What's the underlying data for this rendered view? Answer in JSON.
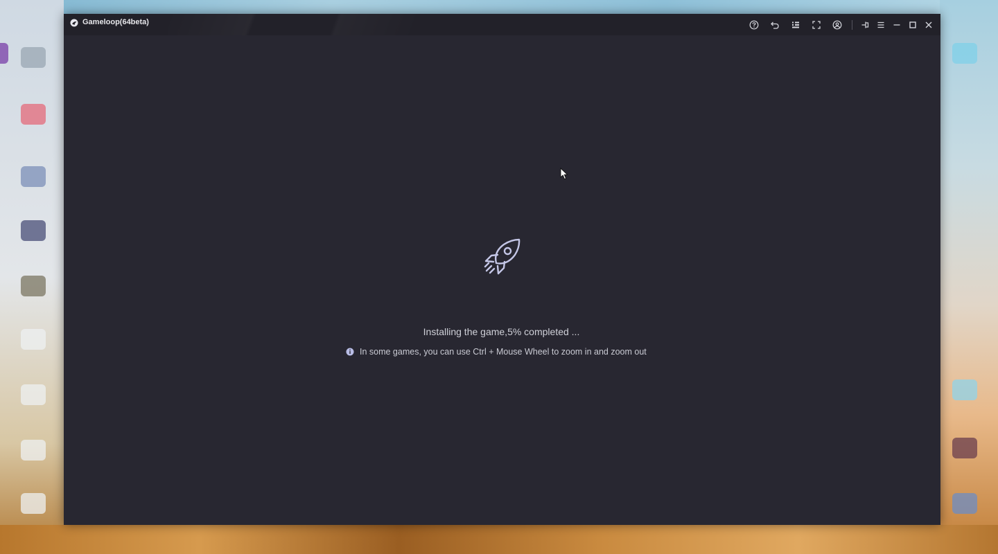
{
  "window": {
    "title": "Gameloop(64beta)",
    "background": "#282731",
    "titlebar_background": "#222129"
  },
  "toolbar": {
    "buttons": [
      {
        "name": "help",
        "icon": "help-icon"
      },
      {
        "name": "undo",
        "icon": "undo-icon"
      },
      {
        "name": "keymapping",
        "icon": "keymap-icon"
      },
      {
        "name": "fullscreen",
        "icon": "fullscreen-icon"
      },
      {
        "name": "account",
        "icon": "account-icon"
      },
      {
        "name": "pin",
        "icon": "pin-icon"
      },
      {
        "name": "menu",
        "icon": "menu-icon"
      },
      {
        "name": "minimize",
        "icon": "minimize-icon"
      },
      {
        "name": "maximize",
        "icon": "maximize-icon"
      },
      {
        "name": "close",
        "icon": "close-icon"
      }
    ]
  },
  "install": {
    "icon": "rocket-icon",
    "status": "Installing the game,5% completed ...",
    "progress_percent": 5,
    "tip_icon": "info-icon",
    "tip": "In some games, you can use Ctrl + Mouse Wheel to zoom in and zoom out"
  },
  "colors": {
    "icon": "#c4c6e6",
    "text": "#cfd0d8"
  }
}
